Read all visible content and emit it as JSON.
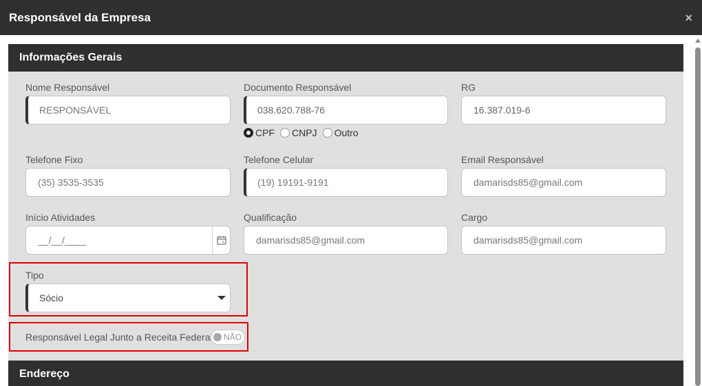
{
  "modal": {
    "title": "Responsável da Empresa",
    "close_label": "×"
  },
  "sections": {
    "general": "Informações Gerais",
    "address": "Endereço"
  },
  "fields": {
    "nome": {
      "label": "Nome Responsável",
      "placeholder": "RESPONSÁVEL"
    },
    "documento": {
      "label": "Documento Responsável",
      "value": "038.620.788-76",
      "options": [
        {
          "label": "CPF",
          "checked": true
        },
        {
          "label": "CNPJ",
          "checked": false
        },
        {
          "label": "Outro",
          "checked": false
        }
      ]
    },
    "rg": {
      "label": "RG",
      "value": "16.387.019-6"
    },
    "telefone_fixo": {
      "label": "Telefone Fixo",
      "value": "(35) 3535-3535"
    },
    "telefone_celular": {
      "label": "Telefone Celular",
      "value": "(19) 19191-9191"
    },
    "email": {
      "label": "Email Responsável",
      "value": "damarisds85@gmail.com"
    },
    "inicio": {
      "label": "Início Atividades",
      "value": "__/__/____"
    },
    "qualificacao": {
      "label": "Qualificação",
      "value": "damarisds85@gmail.com"
    },
    "cargo": {
      "label": "Cargo",
      "value": "damarisds85@gmail.com"
    },
    "tipo": {
      "label": "Tipo",
      "value": "Sócio"
    },
    "responsavel_legal": {
      "label": "Responsável Legal Junto a Receita Federal",
      "toggle_text": "NÃO",
      "on": false
    }
  },
  "colors": {
    "header_bg": "#2f2f2f",
    "body_bg": "#e0e0e0",
    "highlight": "#e00000"
  },
  "icons": {
    "close": "close-icon",
    "calendar": "calendar-icon",
    "dropdown": "chevron-down-icon"
  }
}
